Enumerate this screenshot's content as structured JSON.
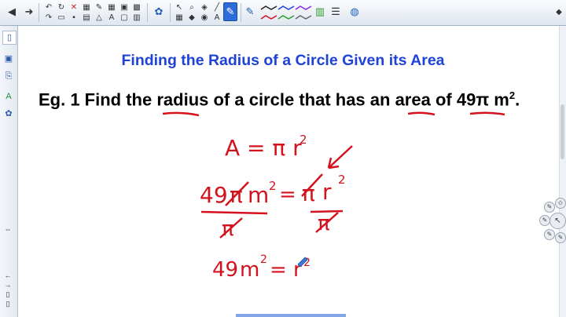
{
  "lesson": {
    "title": "Finding the Radius of a Circle Given its Area",
    "example_prefix": "Eg. 1  Find the ",
    "word_radius": "radius",
    "mid_text": " of a circle that has an ",
    "word_area": "area",
    "of_text": " of ",
    "area_value": "49π",
    "unit": "m",
    "unit_exp": "2",
    "end_punct": "."
  },
  "handwriting": {
    "ink_color": "#d3121e",
    "line1": "A = π r",
    "line1_exp": "2",
    "line2_left": "49",
    "line2_pi": "π",
    "line2_unit": "m",
    "line2_exp": "2",
    "line2_eq": "=",
    "line2_right_pi": "π",
    "line2_right_r": "r",
    "line2_right_exp": "2",
    "denominator_left": "π",
    "denominator_right": "π",
    "line3_left": "49",
    "line3_unit": "m",
    "line3_exp": "2",
    "line3_eq": "= r",
    "line3_exp2": "2"
  },
  "toolbar": {
    "icons": [
      "page-icon",
      "forward-icon",
      "undo-icon",
      "redo-icon",
      "delete-icon",
      "screen-shade-icon",
      "table-icon",
      "text-icon",
      "capture-icon",
      "select-icon",
      "pen-icon",
      "eraser-icon",
      "line-icon",
      "shape-icon",
      "fill-icon",
      "properties-icon",
      "settings-icon"
    ]
  },
  "colors": {
    "title_blue": "#1f43d6",
    "ink_red": "#d3121e",
    "toolbar_highlight": "#2d6bd6"
  }
}
